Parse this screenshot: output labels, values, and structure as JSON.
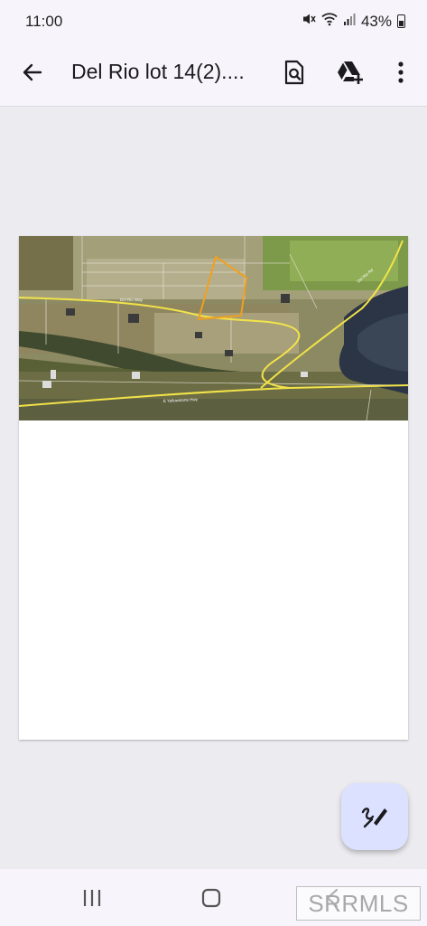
{
  "status_bar": {
    "time": "11:00",
    "battery_percent": "43%",
    "icons": [
      "mute-icon",
      "wifi-icon",
      "signal-icon",
      "battery-icon"
    ]
  },
  "app_bar": {
    "title": "Del Rio lot 14(2)....",
    "actions": [
      "search-document-icon",
      "add-to-drive-icon",
      "more-options-icon"
    ]
  },
  "document": {
    "map_labels": {
      "road_top": "Del Rio Way",
      "road_bottom": "E Yellowstone Hwy",
      "road_right": "Del Rio Rd"
    }
  },
  "fab": {
    "icon": "annotate-pen-icon"
  },
  "nav_bar": {
    "buttons": [
      "recents-icon",
      "home-icon",
      "back-icon"
    ]
  },
  "watermark": {
    "text": "SRRMLS"
  },
  "colors": {
    "surface": "#f7f5fb",
    "background": "#ebebf0",
    "fab": "#dbe1ff",
    "parcel_outline": "#f0a020",
    "road_line": "#f2e34a"
  }
}
